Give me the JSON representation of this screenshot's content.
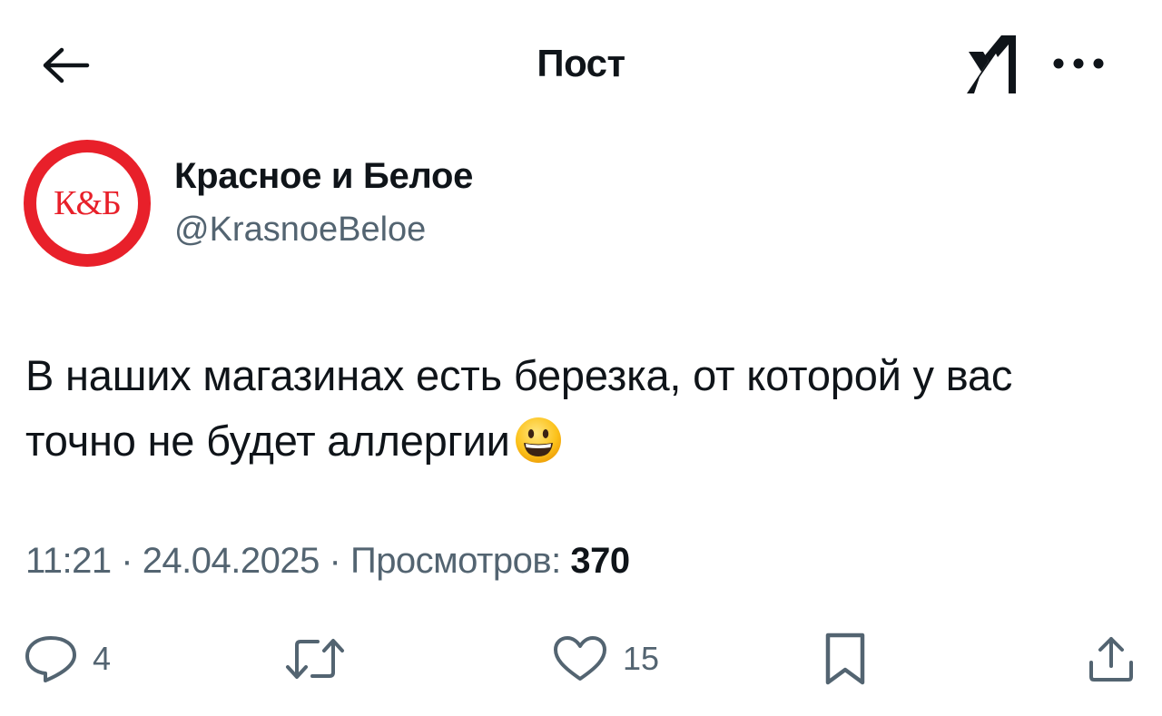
{
  "header": {
    "title": "Пост",
    "back_icon": "arrow-left-icon",
    "grok_icon": "grok-icon",
    "more_icon": "more-horizontal-icon"
  },
  "author": {
    "avatar_text": "К&Б",
    "name": "Красное и Белое",
    "handle": "@KrasnoeBeloe",
    "brand_color": "#e8202a"
  },
  "post": {
    "text": "В наших магазинах есть березка, от которой у вас точно не будет аллергии",
    "emoji": "grinning-face-emoji"
  },
  "meta": {
    "time": "11:21",
    "separator": " · ",
    "date": "24.04.2025",
    "views_label": "Просмотров:",
    "views_count": "370"
  },
  "actions": {
    "reply_count": "4",
    "repost_count": "",
    "like_count": "15",
    "icons": [
      "reply-icon",
      "repost-icon",
      "like-icon",
      "bookmark-icon",
      "share-icon"
    ]
  },
  "colors": {
    "text_primary": "#0f1419",
    "text_secondary": "#536471"
  }
}
